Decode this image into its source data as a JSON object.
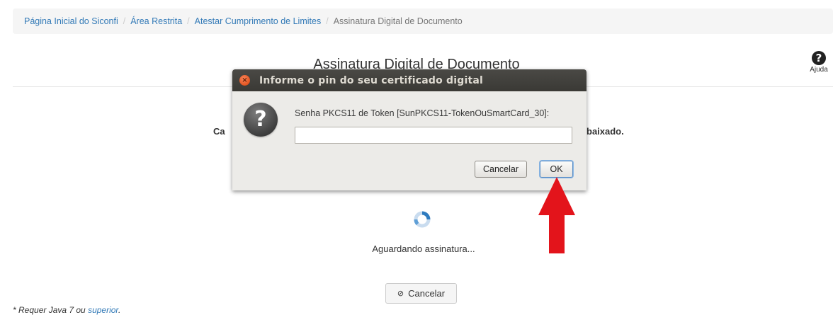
{
  "breadcrumb": {
    "items": [
      "Página Inicial do Siconfi",
      "Área Restrita",
      "Atestar Cumprimento de Limites"
    ],
    "current": "Assinatura Digital de Documento",
    "separator": "/"
  },
  "page": {
    "title": "Assinatura Digital de Documento",
    "help_label": "Ajuda",
    "help_icon": "question-circle-icon",
    "hidden_text_left": "Ca",
    "hidden_text_right": "baixado.",
    "waiting_text": "Aguardando assinatura...",
    "cancel_button": "Cancelar",
    "footnote_prefix": "* Requer Java 7 ou ",
    "footnote_link": "superior",
    "footnote_suffix": "."
  },
  "dialog": {
    "title": "Informe o pin do seu certificado digital",
    "message": "Senha PKCS11 de Token [SunPKCS11-TokenOuSmartCard_30]:",
    "input_value": "",
    "cancel_label": "Cancelar",
    "ok_label": "OK",
    "icon": "question-icon"
  },
  "annotation": {
    "arrow_color": "#e3141b",
    "arrow_direction": "up"
  },
  "colors": {
    "link": "#337ab7",
    "breadcrumb_bg": "#f5f5f5",
    "spinner": "#2e7bbf"
  }
}
